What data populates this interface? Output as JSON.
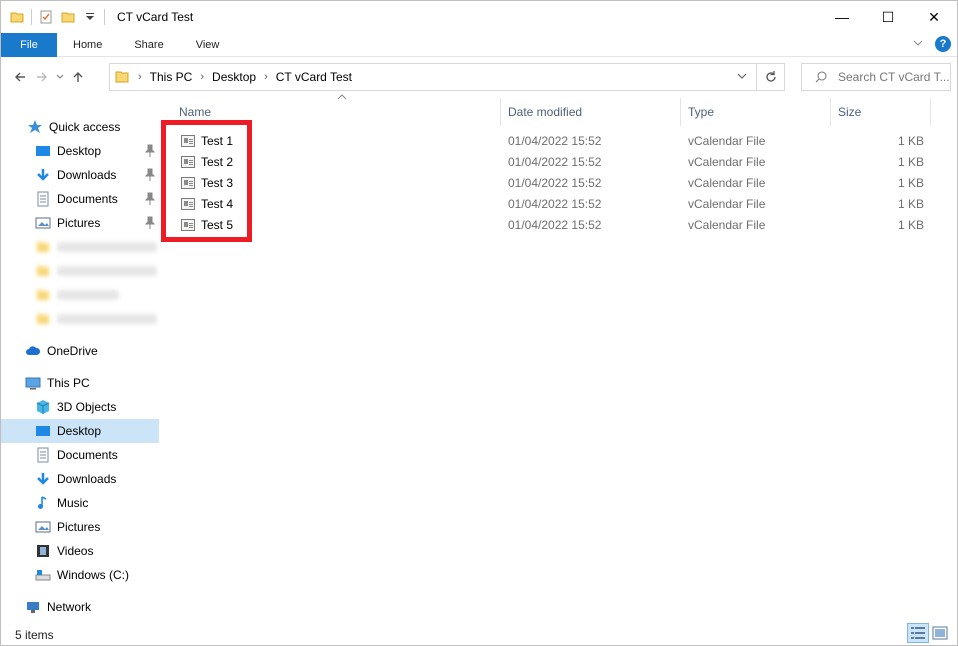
{
  "window": {
    "title": "CT vCard Test",
    "minimize": "—",
    "maximize": "☐",
    "close": "✕"
  },
  "ribbon": {
    "tabs": [
      "File",
      "Home",
      "Share",
      "View"
    ],
    "help": "?"
  },
  "address": {
    "segments": [
      "This PC",
      "Desktop",
      "CT vCard Test"
    ],
    "search_placeholder": "Search CT vCard T..."
  },
  "nav": {
    "quick_access": "Quick access",
    "quick_items": [
      "Desktop",
      "Downloads",
      "Documents",
      "Pictures"
    ],
    "onedrive": "OneDrive",
    "this_pc": "This PC",
    "pc_items": [
      "3D Objects",
      "Desktop",
      "Documents",
      "Downloads",
      "Music",
      "Pictures",
      "Videos",
      "Windows (C:)"
    ],
    "network": "Network"
  },
  "columns": {
    "name": "Name",
    "date": "Date modified",
    "type": "Type",
    "size": "Size"
  },
  "files": [
    {
      "name": "Test 1",
      "date": "01/04/2022 15:52",
      "type": "vCalendar File",
      "size": "1 KB"
    },
    {
      "name": "Test 2",
      "date": "01/04/2022 15:52",
      "type": "vCalendar File",
      "size": "1 KB"
    },
    {
      "name": "Test 3",
      "date": "01/04/2022 15:52",
      "type": "vCalendar File",
      "size": "1 KB"
    },
    {
      "name": "Test 4",
      "date": "01/04/2022 15:52",
      "type": "vCalendar File",
      "size": "1 KB"
    },
    {
      "name": "Test 5",
      "date": "01/04/2022 15:52",
      "type": "vCalendar File",
      "size": "1 KB"
    }
  ],
  "status": {
    "count": "5 items"
  },
  "colors": {
    "accent": "#1979ca",
    "selection": "#cce4f7",
    "highlight": "#ee1c25",
    "folder": "#f8d775"
  }
}
